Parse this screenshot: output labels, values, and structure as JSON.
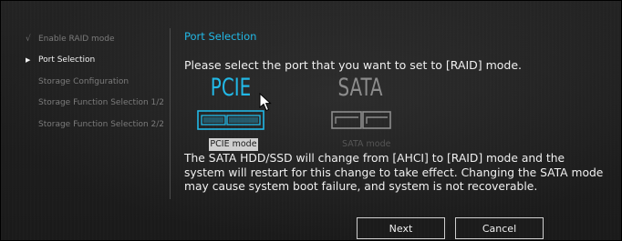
{
  "sidebar": {
    "items": [
      {
        "label": "Enable RAID mode",
        "marker": "√",
        "state": "done"
      },
      {
        "label": "Port Selection",
        "marker": "▶",
        "state": "active"
      },
      {
        "label": "Storage Configuration",
        "marker": "",
        "state": "pending"
      },
      {
        "label": "Storage Function Selection 1/2",
        "marker": "",
        "state": "pending"
      },
      {
        "label": "Storage Function Selection 2/2",
        "marker": "",
        "state": "pending"
      }
    ]
  },
  "main": {
    "title": "Port Selection",
    "prompt": "Please select the port that you want to set to [RAID] mode.",
    "options": [
      {
        "title": "PCIE",
        "label": "PCIE mode",
        "selected": true,
        "icon": "pcie-slot-icon"
      },
      {
        "title": "SATA",
        "label": "SATA mode",
        "selected": false,
        "icon": "sata-port-icon"
      }
    ],
    "warning": "The SATA HDD/SSD will change from [AHCI] to [RAID] mode and the system will restart for this change to take effect. Changing the SATA mode may cause system boot failure, and system is not recoverable."
  },
  "buttons": {
    "next": "Next",
    "cancel": "Cancel"
  },
  "colors": {
    "accent": "#21b8e6",
    "background": "#1c1c1c",
    "inactive_text": "#7a7a7a",
    "selected_label_bg": "#cfcfcf"
  }
}
